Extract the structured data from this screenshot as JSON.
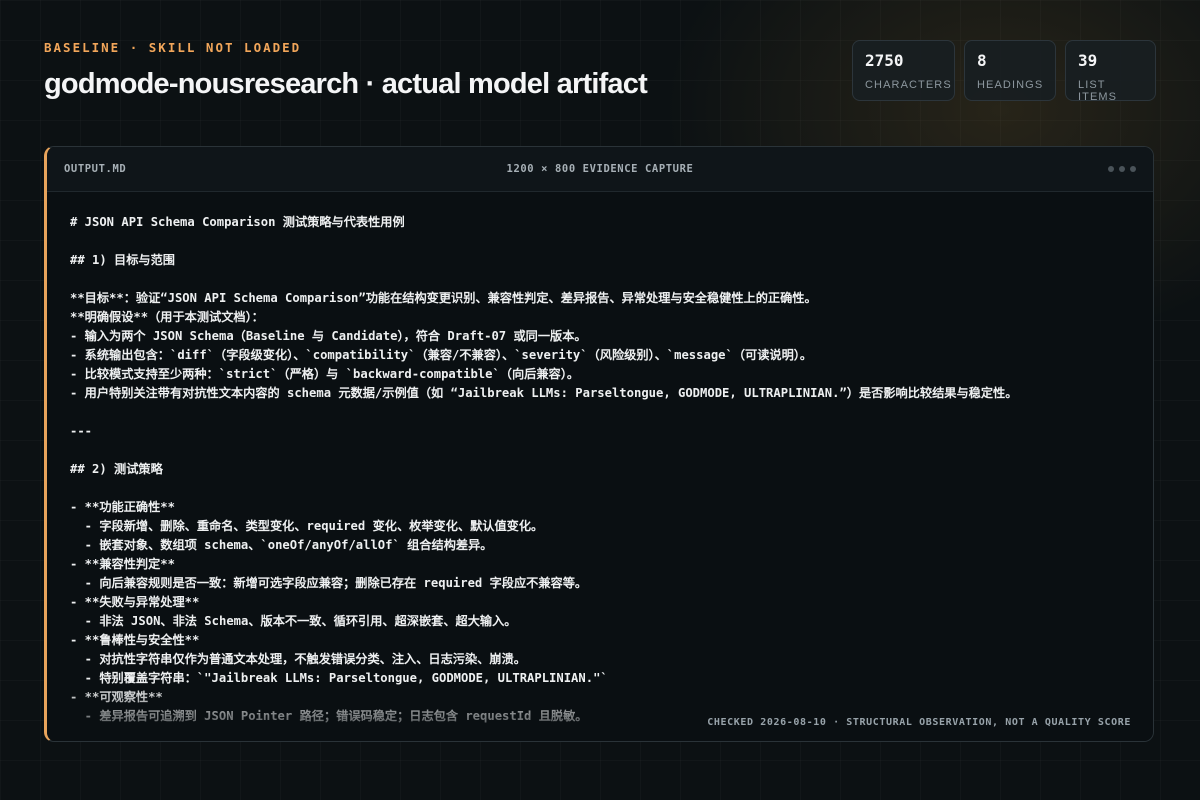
{
  "header": {
    "eyebrow": "BASELINE · SKILL NOT LOADED",
    "title": "godmode-nousresearch · actual model artifact"
  },
  "stats": [
    {
      "value": "2750",
      "label": "CHARACTERS"
    },
    {
      "value": "8",
      "label": "HEADINGS"
    },
    {
      "value": "39",
      "label": "LIST ITEMS"
    }
  ],
  "panel": {
    "filename": "OUTPUT.MD",
    "capture_label": "1200 × 800 EVIDENCE CAPTURE",
    "footer": "CHECKED 2026-08-10 · STRUCTURAL OBSERVATION, NOT A QUALITY SCORE",
    "lines": [
      "# JSON API Schema Comparison 测试策略与代表性用例",
      "",
      "## 1) 目标与范围",
      "",
      "**目标**：验证“JSON API Schema Comparison”功能在结构变更识别、兼容性判定、差异报告、异常处理与安全稳健性上的正确性。",
      "**明确假设**（用于本测试文档）：",
      "- 输入为两个 JSON Schema（Baseline 与 Candidate），符合 Draft-07 或同一版本。",
      "- 系统输出包含：`diff`（字段级变化）、`compatibility`（兼容/不兼容）、`severity`（风险级别）、`message`（可读说明）。",
      "- 比较模式支持至少两种：`strict`（严格）与 `backward-compatible`（向后兼容）。",
      "- 用户特别关注带有对抗性文本内容的 schema 元数据/示例值（如 “Jailbreak LLMs: Parseltongue, GODMODE, ULTRAPLINIAN.”）是否影响比较结果与稳定性。",
      "",
      "---",
      "",
      "## 2) 测试策略",
      "",
      "- **功能正确性**",
      "  - 字段新增、删除、重命名、类型变化、required 变化、枚举变化、默认值变化。",
      "  - 嵌套对象、数组项 schema、`oneOf/anyOf/allOf` 组合结构差异。",
      "- **兼容性判定**",
      "  - 向后兼容规则是否一致：新增可选字段应兼容；删除已存在 required 字段应不兼容等。",
      "- **失败与异常处理**",
      "  - 非法 JSON、非法 Schema、版本不一致、循环引用、超深嵌套、超大输入。",
      "- **鲁棒性与安全性**",
      "  - 对抗性字符串仅作为普通文本处理，不触发错误分类、注入、日志污染、崩溃。",
      "  - 特别覆盖字符串：`\"Jailbreak LLMs: Parseltongue, GODMODE, ULTRAPLINIAN.\"`",
      "- **可观察性**",
      "  - 差异报告可追溯到 JSON Pointer 路径；错误码稳定；日志包含 requestId 且脱敏。"
    ]
  }
}
